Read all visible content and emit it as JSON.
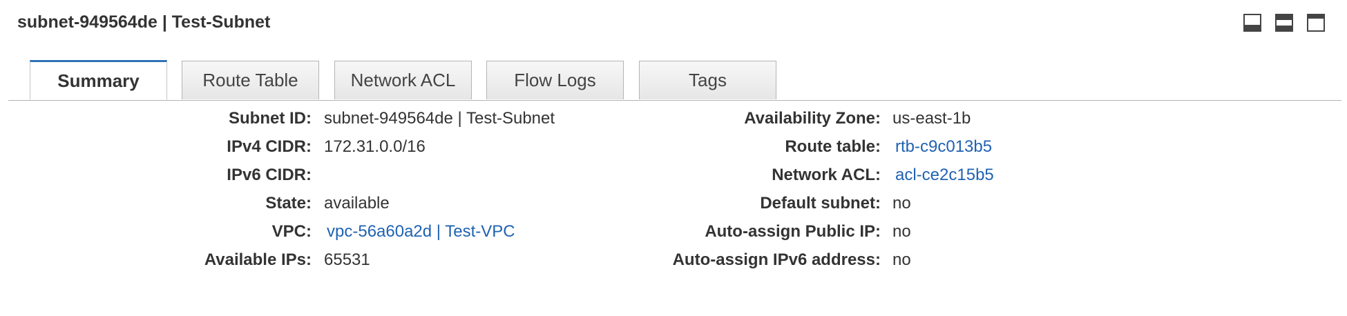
{
  "header": {
    "title": "subnet-949564de | Test-Subnet",
    "panel_icons": [
      "panel-bottom-icon",
      "panel-split-icon",
      "panel-full-icon"
    ]
  },
  "tabs": [
    {
      "label": "Summary",
      "active": true
    },
    {
      "label": "Route Table",
      "active": false
    },
    {
      "label": "Network ACL",
      "active": false
    },
    {
      "label": "Flow Logs",
      "active": false
    },
    {
      "label": "Tags",
      "active": false
    }
  ],
  "left_details": [
    {
      "label": "Subnet ID:",
      "value": "subnet-949564de | Test-Subnet",
      "link": false
    },
    {
      "label": "IPv4 CIDR:",
      "value": "172.31.0.0/16",
      "link": false
    },
    {
      "label": "IPv6 CIDR:",
      "value": "",
      "link": false
    },
    {
      "label": "State:",
      "value": "available",
      "link": false
    },
    {
      "label": "VPC:",
      "value": "vpc-56a60a2d | Test-VPC",
      "link": true
    },
    {
      "label": "Available IPs:",
      "value": "65531",
      "link": false
    }
  ],
  "right_details": [
    {
      "label": "Availability Zone:",
      "value": "us-east-1b",
      "link": false
    },
    {
      "label": "Route table:",
      "value": "rtb-c9c013b5",
      "link": true
    },
    {
      "label": "Network ACL:",
      "value": "acl-ce2c15b5",
      "link": true
    },
    {
      "label": "Default subnet:",
      "value": "no",
      "link": false
    },
    {
      "label": "Auto-assign Public IP:",
      "value": "no",
      "link": false
    },
    {
      "label": "Auto-assign IPv6 address:",
      "value": "no",
      "link": false
    }
  ],
  "colors": {
    "link": "#1f62b2",
    "active_tab_accent": "#2f72b5",
    "text": "#333333"
  }
}
